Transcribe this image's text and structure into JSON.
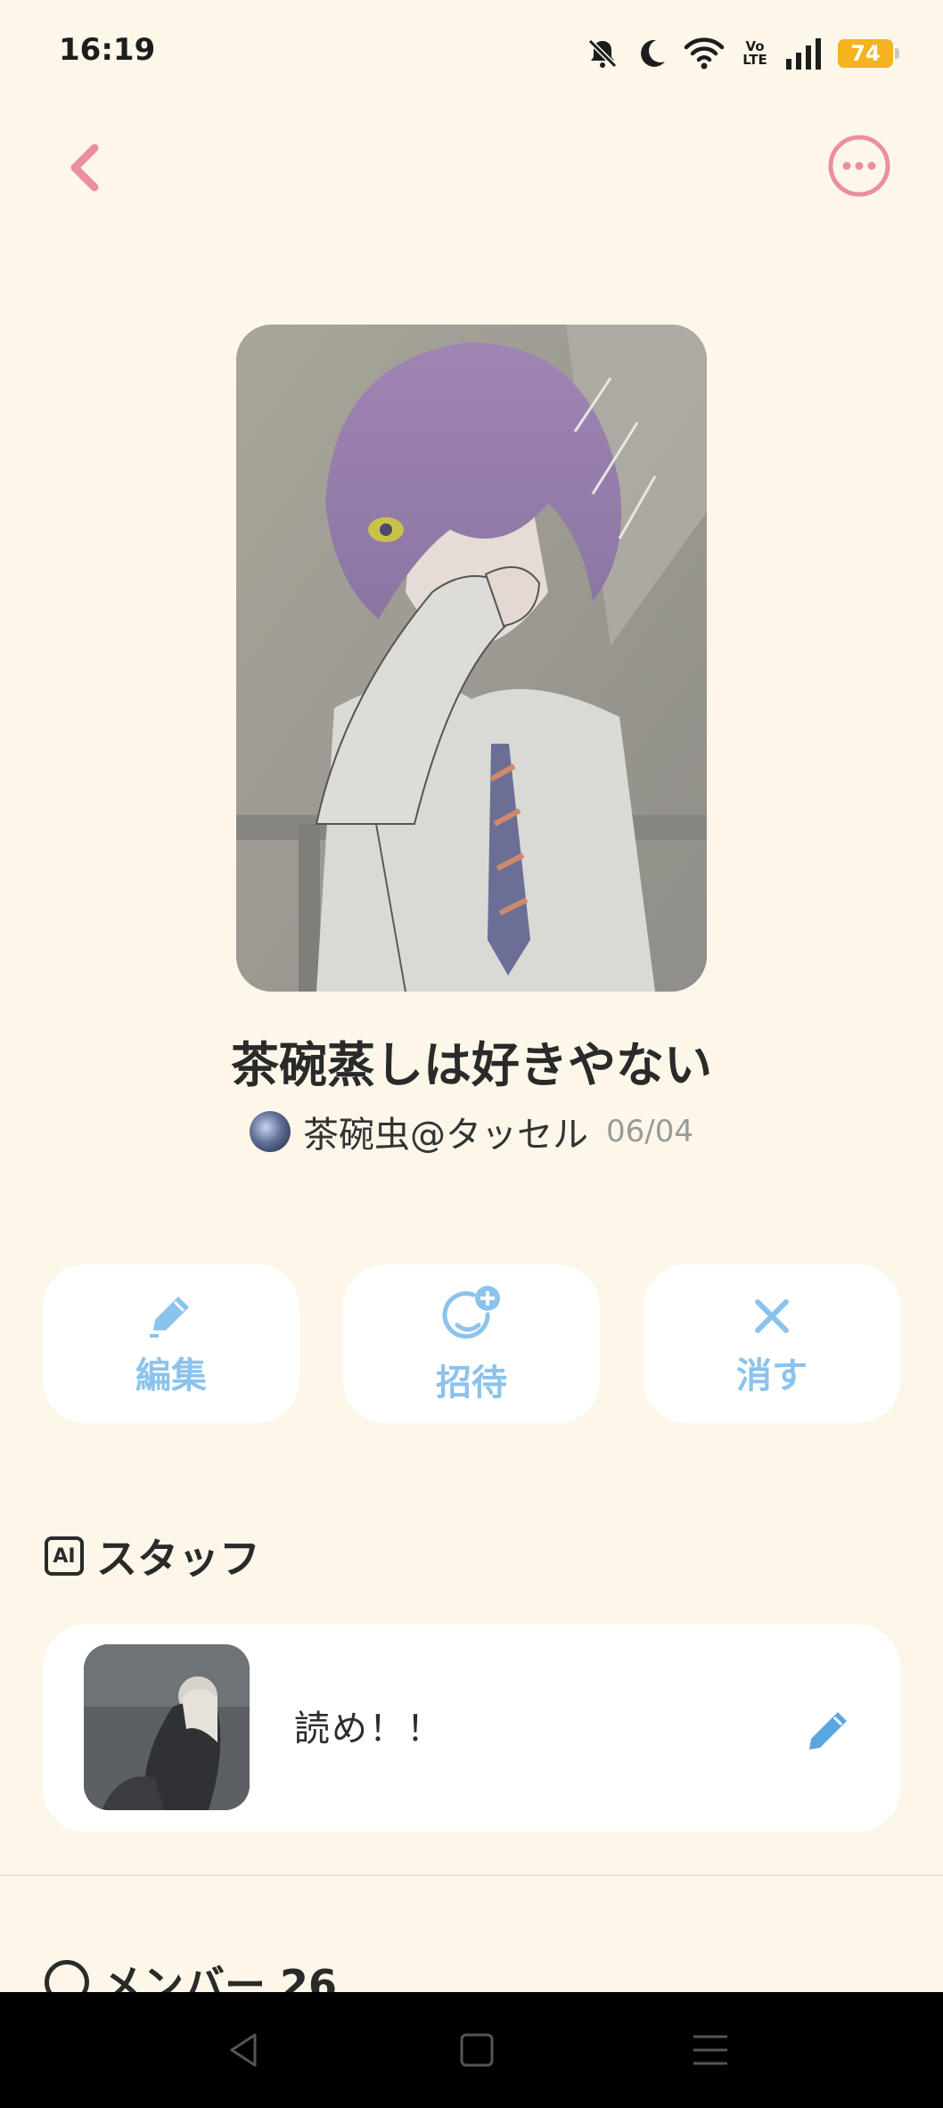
{
  "status_bar": {
    "time": "16:19",
    "battery": "74",
    "network_label": "Vo LTE",
    "icons": [
      "mute-icon",
      "moon-icon",
      "wifi-icon",
      "volte-icon",
      "signal-icon",
      "battery-icon"
    ]
  },
  "nav": {
    "back_icon": "chevron-left-icon",
    "more_icon": "more-horizontal-icon",
    "accent": "#ea8ea0"
  },
  "story": {
    "title": "茶碗蒸しは好きやない",
    "author": "茶碗虫@タッセル",
    "date": "06/04"
  },
  "actions": [
    {
      "label": "編集",
      "icon": "pencil-icon"
    },
    {
      "label": "招待",
      "icon": "add-face-icon"
    },
    {
      "label": "消す",
      "icon": "close-icon"
    }
  ],
  "action_color": "#8cc3ec",
  "staff": {
    "badge": "AI",
    "heading": "スタッフ",
    "message": "読め！！",
    "edit_icon": "pencil-icon"
  },
  "members": {
    "heading": "メンバー 26"
  },
  "system_nav": [
    "back-triangle-icon",
    "home-square-icon",
    "menu-lines-icon"
  ]
}
